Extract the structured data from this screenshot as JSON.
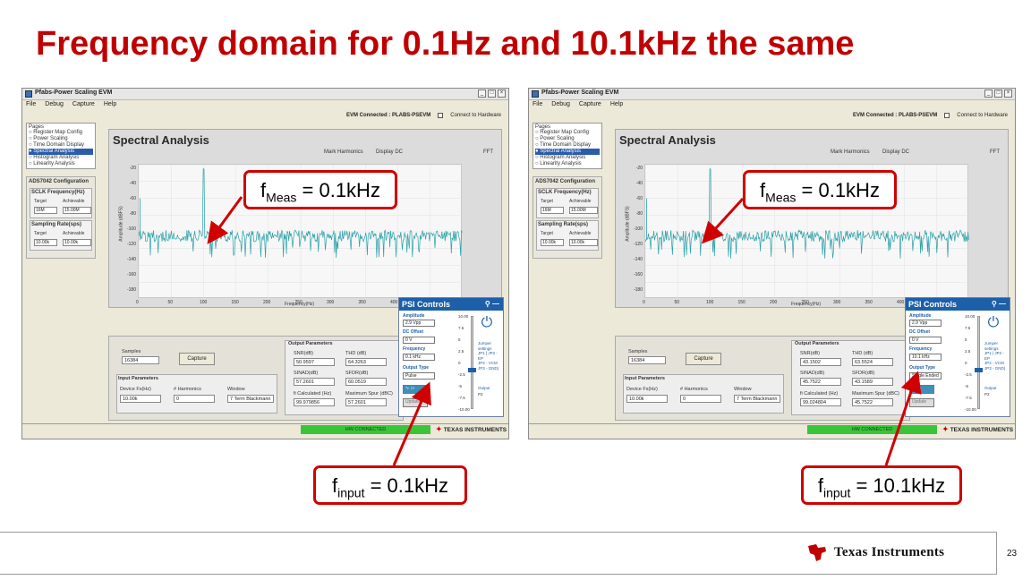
{
  "slide": {
    "title": "Frequency domain for 0.1Hz and 10.1kHz the same",
    "page_number": "23",
    "footer_brand": "Texas Instruments"
  },
  "screenshots": [
    {
      "window_title": "Pfabs-Power Scaling EVM",
      "menu": [
        "File",
        "Debug",
        "Capture",
        "Help"
      ],
      "evm_status": "EVM Connected : PLABS-PSEVM",
      "connect_label": "Connect to Hardware",
      "pages_header": "Pages",
      "pages": [
        "Register Map Config",
        "Power Scaling",
        "Time Domain Display",
        "Spectral Analysis",
        "Histogram Analysis",
        "Linearity Analysis"
      ],
      "selected_page": 3,
      "config_title": "ADS7042 Configuration",
      "sclk_title": "SCLK Frequency(Hz)",
      "sclk_target_label": "Target",
      "sclk_achieved_label": "Achievable",
      "sclk_target": "16M",
      "sclk_achieved": "15.00M",
      "sr_title": "Sampling Rate(sps)",
      "sr_target": "10.00k",
      "sr_achieved": "10.00k",
      "panel_title": "Spectral Analysis",
      "mark_harmonics": "Mark Harmonics",
      "display_dc": "Display DC",
      "fft_label": "FFT",
      "y_axis_label": "Amplitude (dBFS)",
      "x_axis_label": "Frequency(Hz)",
      "y_ticks": [
        "-20",
        "-40",
        "-60",
        "-80",
        "-100",
        "-120",
        "-140",
        "-160",
        "-180"
      ],
      "x_ticks": [
        "0",
        "50",
        "100",
        "150",
        "200",
        "250",
        "300",
        "350",
        "400",
        "450",
        "500"
      ],
      "samples_label": "Samples",
      "samples_value": "16384",
      "capture_btn": "Capture",
      "input_params": "Input Parameters",
      "device_fs_label": "Device Fs(Hz)",
      "device_fs": "10.00k",
      "harmonics_label": "# Harmonics",
      "harmonics": "0",
      "window_label": "Window",
      "window_value": "7 Term Blackmann",
      "output_params": "Output Parameters",
      "snr_label": "SNR(dB)",
      "snr": "50.9597",
      "thd_label": "THD (dB)",
      "thd": "64.3263",
      "sinad_label": "SINAD(dB)",
      "sinad": "57.2601",
      "sfdr_label": "SFDR(dB)",
      "sfdr": "60.0519",
      "fi_label": "fi Calculated (Hz)",
      "fi": "99.979856",
      "maxspur_label": "Maximum Spur (dBC)",
      "maxspur": "57.2601",
      "psi_title": "PSI Controls",
      "amplitude_label": "Amplitude",
      "amplitude": "2.9 Vpp",
      "dc_offset_label": "DC Offset",
      "dc_offset": "0 V",
      "frequency_label": "Frequency",
      "frequency": "0.1 kHz",
      "output_type_label": "Output Type",
      "output_type": "Pulse",
      "update_btn": "Update",
      "jumper_text": [
        "Jumper",
        "settings",
        "JP1 | JP2 -",
        "EP",
        "JP4 - VCM",
        "JP3 - GND)"
      ],
      "output_label": "Output",
      "output_value": "P2",
      "psi_scale": [
        "10.00",
        "7.5",
        "5",
        "2.5",
        "0",
        "-2.5",
        "-5",
        "-7.5",
        "-10.00"
      ],
      "hw_status": "HW CONNECTED",
      "ti_logo": "TEXAS INSTRUMENTS",
      "spike_freq": 100,
      "slider_level": 0.42
    },
    {
      "window_title": "Pfabs-Power Scaling EVM",
      "menu": [
        "File",
        "Debug",
        "Capture",
        "Help"
      ],
      "evm_status": "EVM Connected : PLABS-PSEVM",
      "connect_label": "Connect to Hardware",
      "pages_header": "Pages",
      "pages": [
        "Register Map Config",
        "Power Scaling",
        "Time Domain Display",
        "Spectral Analysis",
        "Histogram Analysis",
        "Linearity Analysis"
      ],
      "selected_page": 3,
      "config_title": "ADS7042 Configuration",
      "sclk_title": "SCLK Frequency(Hz)",
      "sclk_target_label": "Target",
      "sclk_achieved_label": "Achievable",
      "sclk_target": "16M",
      "sclk_achieved": "15.00M",
      "sr_title": "Sampling Rate(sps)",
      "sr_target": "10.00k",
      "sr_achieved": "10.00k",
      "panel_title": "Spectral Analysis",
      "mark_harmonics": "Mark Harmonics",
      "display_dc": "Display DC",
      "fft_label": "FFT",
      "y_axis_label": "Amplitude (dBFS)",
      "x_axis_label": "Frequency(Hz)",
      "y_ticks": [
        "-20",
        "-40",
        "-60",
        "-80",
        "-100",
        "-120",
        "-140",
        "-160",
        "-180"
      ],
      "x_ticks": [
        "0",
        "50",
        "100",
        "150",
        "200",
        "250",
        "300",
        "350",
        "400",
        "450",
        "500"
      ],
      "samples_label": "Samples",
      "samples_value": "16384",
      "capture_btn": "Capture",
      "input_params": "Input Parameters",
      "device_fs_label": "Device Fs(Hz)",
      "device_fs": "10.00k",
      "harmonics_label": "# Harmonics",
      "harmonics": "0",
      "window_label": "Window",
      "window_value": "7 Term Blackmann",
      "output_params": "Output Parameters",
      "snr_label": "SNR(dB)",
      "snr": "43.1502",
      "thd_label": "THD (dB)",
      "thd": "63.5524",
      "sinad_label": "SINAD(dB)",
      "sinad": "45.7522",
      "sfdr_label": "SFDR(dB)",
      "sfdr": "43.1589",
      "fi_label": "fi Calculated (Hz)",
      "fi": "99.024804",
      "maxspur_label": "Maximum Spur (dBC)",
      "maxspur": "45.7522",
      "psi_title": "PSI Controls",
      "amplitude_label": "Amplitude",
      "amplitude": "2.9 Vpp",
      "dc_offset_label": "DC Offset",
      "dc_offset": "0 V",
      "frequency_label": "Frequency",
      "frequency": "10.1 kHz",
      "output_type_label": "Output Type",
      "output_type": "Single Ended",
      "update_btn": "Update",
      "jumper_text": [
        "Jumper",
        "settings",
        "JP1 | JP2 -",
        "EP",
        "JP4 - VCM",
        "JP3 - GND)"
      ],
      "output_label": "Output",
      "output_value": "P2",
      "psi_scale": [
        "10.00",
        "7.5",
        "5",
        "2.5",
        "0",
        "-2.5",
        "-5",
        "-7.5",
        "-10.00"
      ],
      "hw_status": "HW CONNECTED",
      "ti_logo": "TEXAS INSTRUMENTS",
      "spike_freq": 100,
      "slider_level": 0.42
    }
  ],
  "callouts": {
    "fmeas_left": {
      "main": "f",
      "sub": "Meas",
      "rest": " = 0.1kHz"
    },
    "fmeas_right": {
      "main": "f",
      "sub": "Meas",
      "rest": " = 0.1kHz"
    },
    "finput_left": {
      "main": "f",
      "sub": "input",
      "rest": " = 0.1kHz"
    },
    "finput_right": {
      "main": "f",
      "sub": "input",
      "rest": " = 10.1kHz"
    }
  },
  "colors": {
    "title": "#c00000",
    "callout_border": "#d00000",
    "psi_blue": "#1d5fa8",
    "hw_green": "#39c439",
    "trace": "#2aa0a8"
  }
}
